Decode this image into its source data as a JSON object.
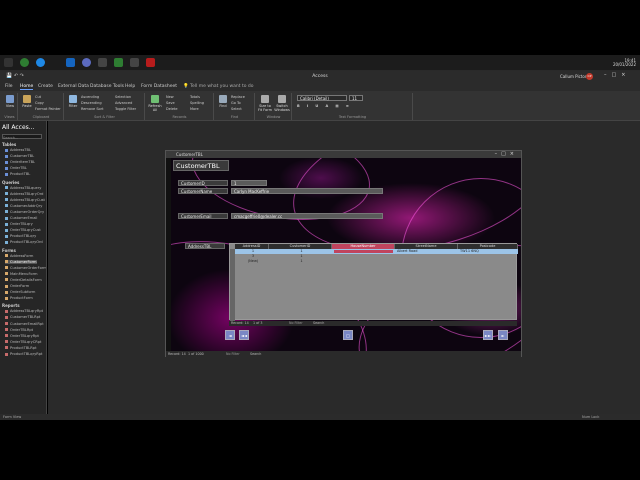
{
  "taskbar": {
    "time": "19:41",
    "date": "20/01/2022"
  },
  "app": {
    "title": "Access",
    "user": "Callum Picton",
    "user_initials": "CP"
  },
  "tabs": [
    "File",
    "Home",
    "Create",
    "External Data",
    "Database Tools",
    "Help",
    "Form Datasheet"
  ],
  "tell_me": "Tell me what you want to do",
  "ribbon": {
    "groups": [
      "Views",
      "Clipboard",
      "Sort & Filter",
      "Records",
      "Find",
      "Window",
      "Text Formatting"
    ],
    "view_label": "View",
    "paste_label": "Paste",
    "filter_label": "Filter",
    "refresh_label": "Refresh All",
    "find_label": "Find",
    "size_label": "Size to Fit Form",
    "switch_label": "Switch Windows",
    "small": {
      "cut": "Cut",
      "copy": "Copy",
      "format_painter": "Format Painter",
      "ascending": "Ascending",
      "descending": "Descending",
      "remove_sort": "Remove Sort",
      "selection": "Selection",
      "advanced": "Advanced",
      "toggle_filter": "Toggle Filter",
      "new": "New",
      "save": "Save",
      "delete": "Delete",
      "totals": "Totals",
      "spelling": "Spelling",
      "more": "More",
      "replace": "Replace",
      "goto": "Go To",
      "select": "Select"
    },
    "font": "Calibri (Detail)",
    "font_size": "11"
  },
  "nav": {
    "title": "All Acces...",
    "search_placeholder": "Search...",
    "sections": [
      {
        "name": "Tables",
        "items": [
          "AddressTBL",
          "CustomerTBL",
          "OrderItemTBL",
          "OrderTBL",
          "ProductTBL"
        ],
        "kind": ""
      },
      {
        "name": "Queries",
        "items": [
          "AddressTBLquery",
          "AddressTBLqryOrd",
          "AddressTBLqryCust",
          "CustomerAddrQry",
          "CustomerOrderQry",
          "CustomerEmail",
          "OrderTBLqry",
          "OrderTBLqryCust",
          "ProductTBLqry",
          "ProductTBLqryOrd"
        ],
        "kind": "q"
      },
      {
        "name": "Forms",
        "items": [
          "AddressForm",
          "CustomerForm",
          "CustomerOrderForm",
          "MainMenuForm",
          "OrderDetailsForm",
          "OrderForm",
          "OrderSubform",
          "ProductForm"
        ],
        "kind": "f",
        "selected": 1
      },
      {
        "name": "Reports",
        "items": [
          "AddressTBLqryRpt",
          "CustomerTBLRpt",
          "CustomerEmailRpt",
          "OrderTBLRpt",
          "OrderTBLqryRpt",
          "OrderTBLqryCRpt",
          "ProductTBLRpt",
          "ProductTBLqryRpt"
        ],
        "kind": "r"
      }
    ]
  },
  "status": {
    "left": "Form View",
    "right": "Num Lock"
  },
  "form": {
    "window_title": "CustomerTBL",
    "header": "CustomerTBL",
    "fields": {
      "customer_id_label": "CustomerID",
      "customer_id_value": "1",
      "customer_name_label": "CustomerName",
      "customer_name_value": "Carlyn MacKeffrie",
      "customer_email_label": "CustomerEmail",
      "customer_email_value": "cmacgeffrie0@dealer.cc",
      "address_label": "AddressTBL"
    },
    "subform": {
      "columns": [
        "AddressID",
        "CustomerID",
        "HouseNumber",
        "StreetName",
        "Postcode"
      ],
      "rows": [
        [
          "1",
          "1",
          "",
          "Albert Road",
          "TW11 6NQ"
        ],
        [
          "3",
          "1",
          "",
          "",
          ""
        ],
        [
          "(New)",
          "1",
          "",
          "",
          ""
        ]
      ],
      "nav_record": "Record: 14",
      "nav_pos": "1 of 3",
      "nav_filter": "No Filter",
      "nav_search": "Search"
    },
    "footer": {
      "record": "Record: 14",
      "pos": "1 of 1000",
      "filter": "No Filter",
      "search": "Search"
    },
    "buttons": [
      "◄",
      "◄◄",
      "□",
      "►►",
      "►"
    ]
  }
}
